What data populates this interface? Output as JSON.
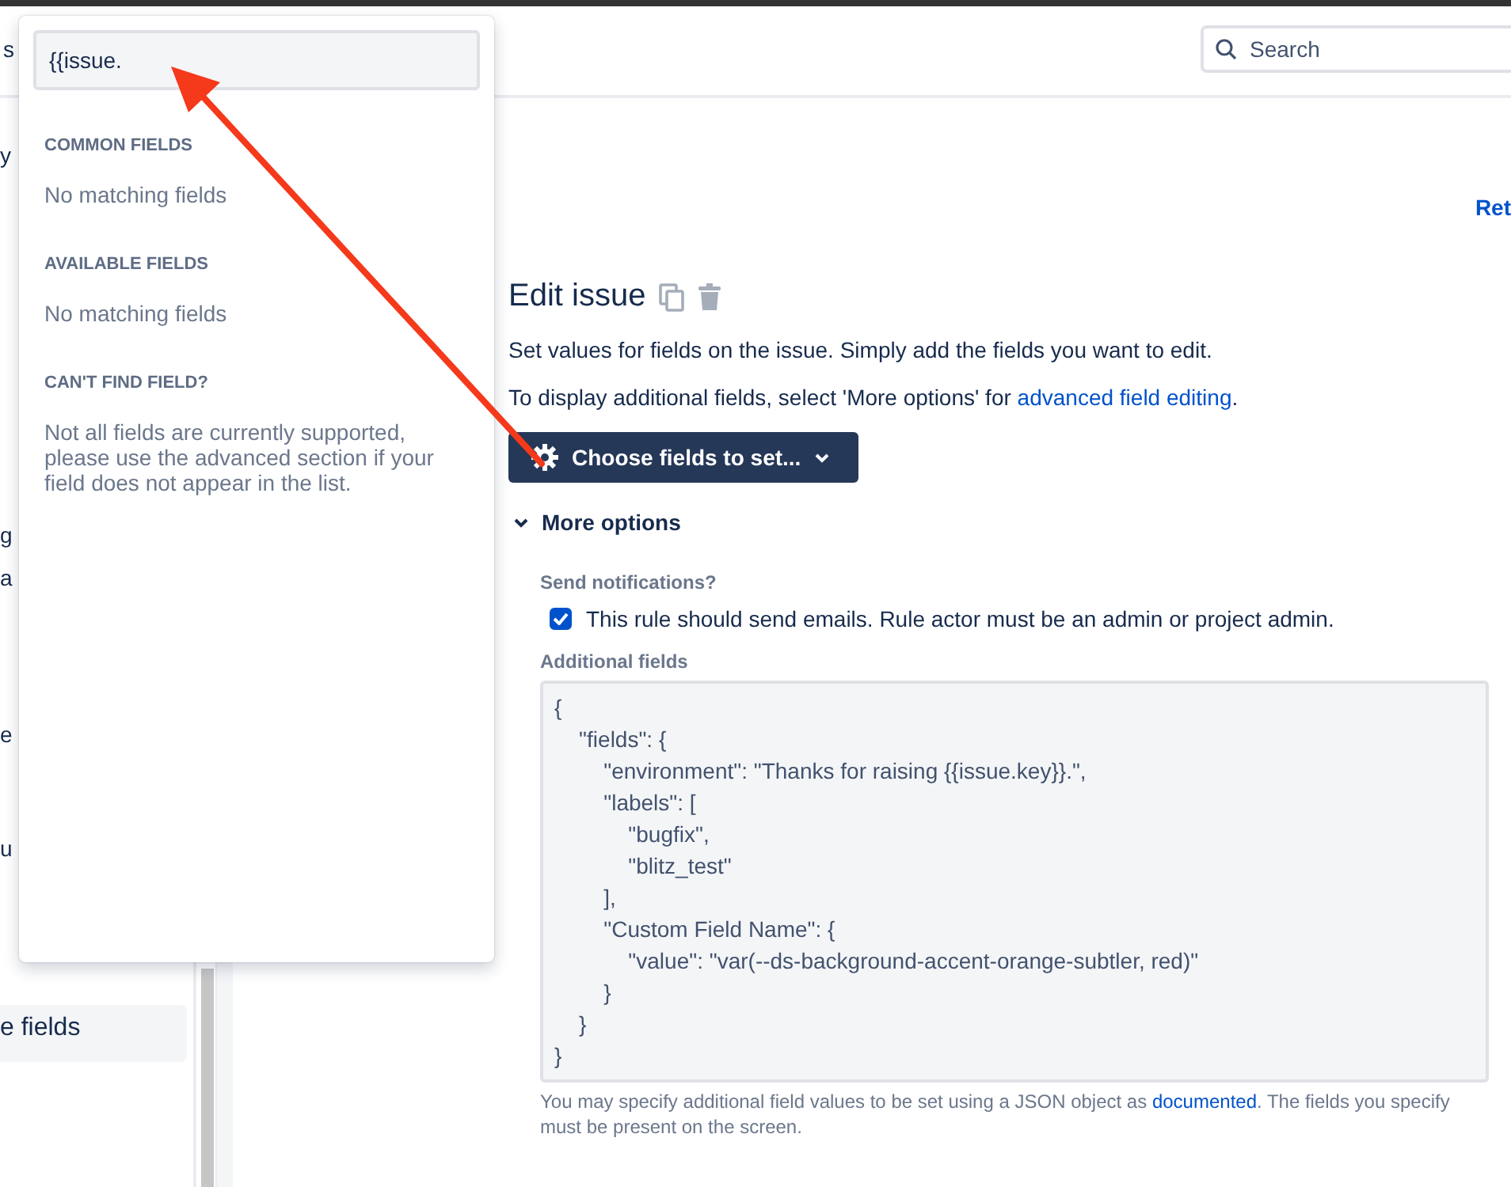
{
  "header": {
    "left_text": "s",
    "search": {
      "placeholder": "Search"
    }
  },
  "sidebar": {
    "items": [
      {
        "label": "y",
        "selected": false
      },
      {
        "label": "g",
        "selected": false
      },
      {
        "label": "a",
        "selected": false
      },
      {
        "label": "e",
        "selected": false
      },
      {
        "label": "u",
        "selected": false
      },
      {
        "label": "e fields",
        "selected": true
      }
    ]
  },
  "top_link": "Ret",
  "action": {
    "title": "Edit issue",
    "description": "Set values for fields on the issue. Simply add the fields you want to edit.",
    "hint_before": "To display additional fields, select 'More options' for ",
    "hint_link": "advanced field editing",
    "hint_after": ".",
    "choose_button": "Choose fields to set...",
    "more_options": {
      "label": "More options",
      "expanded": true
    },
    "notifications": {
      "label": "Send notifications?",
      "checkbox": "This rule should send emails. Rule actor must be an admin or project admin.",
      "checked": true
    },
    "additional": {
      "label": "Additional fields",
      "code": "{\n    \"fields\": {\n        \"environment\": \"Thanks for raising {{issue.key}}.\",\n        \"labels\": [\n            \"bugfix\",\n            \"blitz_test\"\n        ],\n        \"Custom Field Name\": {\n            \"value\": \"var(--ds-background-accent-orange-subtler, red)\"\n        }\n    }\n}",
      "help_before": "You may specify additional field values to be set using a JSON object as ",
      "help_link": "documented",
      "help_after": ". The fields you specify must be present on the screen."
    }
  },
  "popup": {
    "search_value": "{{issue.",
    "sections": [
      {
        "heading": "COMMON FIELDS",
        "text": "No matching fields"
      },
      {
        "heading": "AVAILABLE FIELDS",
        "text": "No matching fields"
      },
      {
        "heading": "CAN'T FIND FIELD?",
        "text": "Not all fields are currently supported, please use the advanced section if your field does not appear in the list."
      }
    ]
  }
}
